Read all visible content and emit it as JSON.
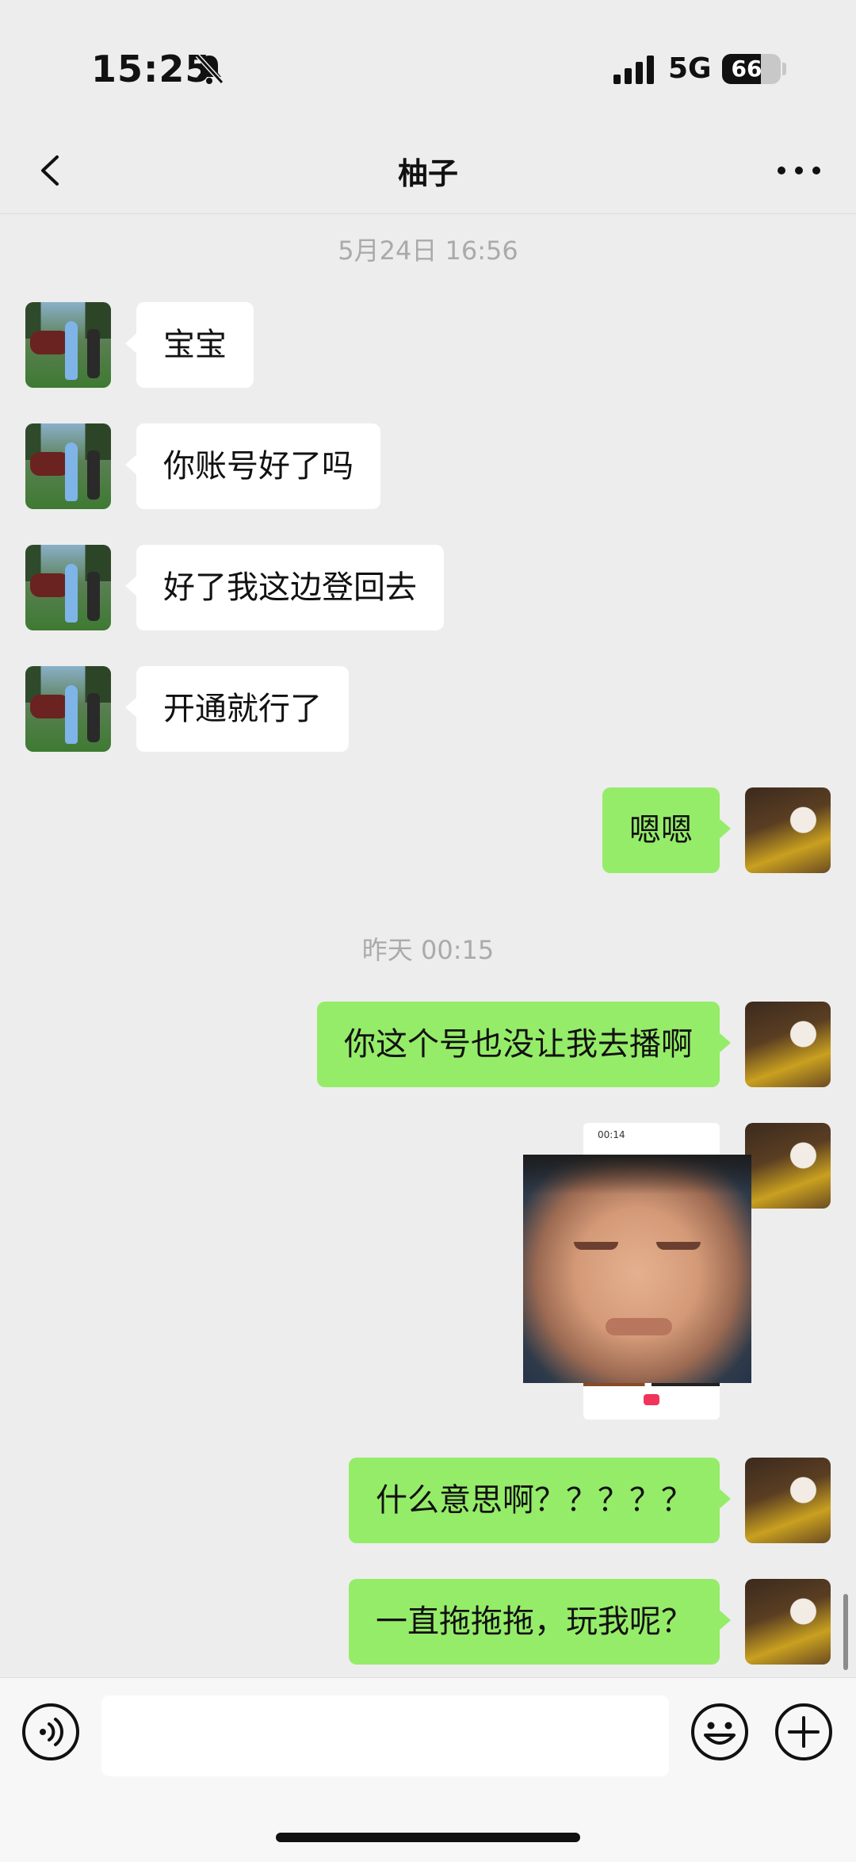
{
  "status_bar": {
    "time": "15:25",
    "network": "5G",
    "battery": "66",
    "battery_level": 0.66
  },
  "header": {
    "title": "柚子"
  },
  "messages": {
    "ts1": "5月24日 16:56",
    "m1": "宝宝",
    "m2": "你账号好了吗",
    "m3": "好了我这边登回去",
    "m4": "开通就行了",
    "m5": "嗯嗯",
    "ts2": "昨天 00:15",
    "m6": "你这个号也没让我去播啊",
    "m7": "什么意思啊？？？？？",
    "m8": "一直拖拖拖，玩我呢？"
  },
  "image_message": {
    "mini_time": "00:14"
  },
  "input": {
    "value": ""
  },
  "icons": {
    "bell": "bell-slash-icon",
    "signal": "signal-icon",
    "back": "chevron-left-icon",
    "more": "more-icon",
    "voice": "voice-icon",
    "emoji": "emoji-icon",
    "plus": "plus-icon"
  },
  "colors": {
    "sent_bubble": "#95ec69",
    "received_bubble": "#ffffff",
    "background": "#ededed"
  }
}
